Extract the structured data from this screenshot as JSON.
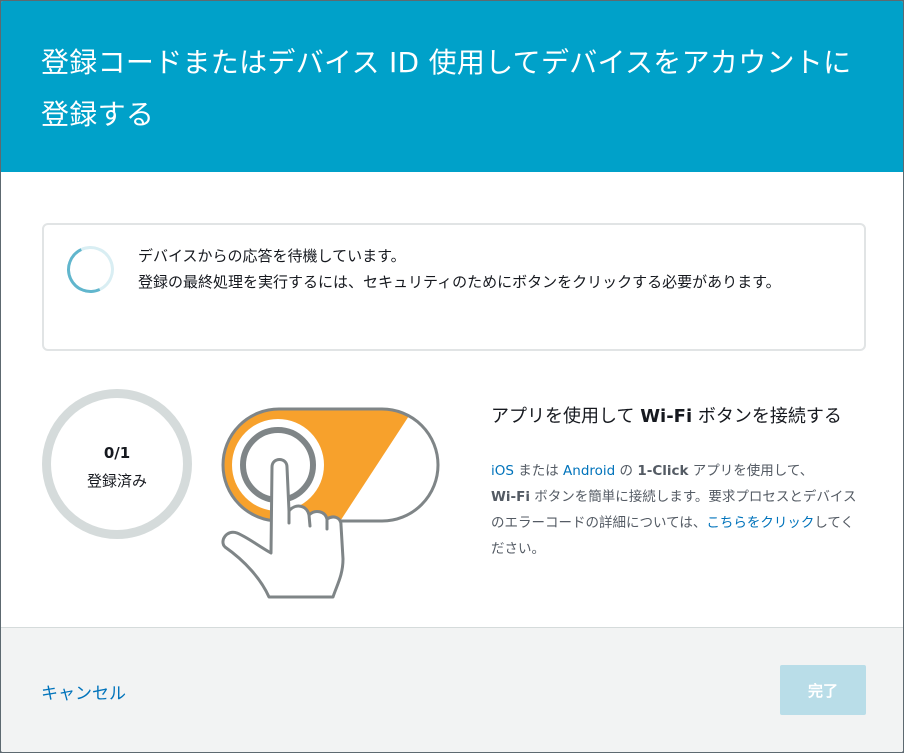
{
  "dialog": {
    "title": "登録コードまたはデバイス ID 使用してデバイスをアカウントに登録する"
  },
  "waiting": {
    "line1": "デバイスからの応答を待機しています。",
    "line2": "登録の最終処理を実行するには、セキュリティのためにボタンをクリックする必要があります。"
  },
  "counter": {
    "count": "0/1",
    "label": "登録済み"
  },
  "info": {
    "title_pre": "アプリを使用して ",
    "title_bold": "Wi-Fi",
    "title_post": " ボタンを接続する",
    "ios": "iOS",
    "or": " または ",
    "android": "Android",
    "no": " の ",
    "oneclick": "1-Click",
    "app_text": " アプリを使用して、",
    "wifi": "Wi-Fi",
    "body_text": " ボタンを簡単に接続します。要求プロセスとデバイスのエラーコードの詳細については、",
    "link": "こちらをクリック",
    "suffix": "してください。"
  },
  "footer": {
    "cancel": "キャンセル",
    "done": "完了"
  },
  "colors": {
    "header": "#00a1c9",
    "button_orange": "#f7a12c",
    "link": "#0073bb",
    "done_disabled": "#b9dde8"
  }
}
